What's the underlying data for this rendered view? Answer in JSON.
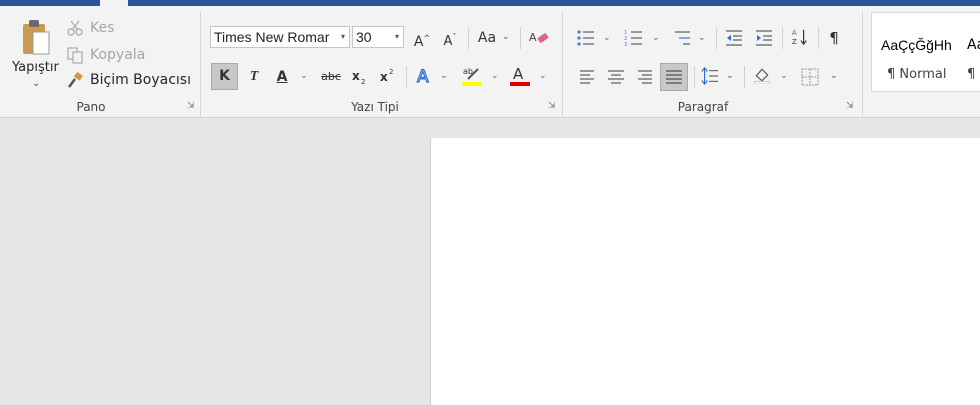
{
  "clipboard": {
    "paste_label": "Yapıştır",
    "cut_label": "Kes",
    "copy_label": "Kopyala",
    "format_painter_label": "Biçim Boyacısı",
    "group_label": "Pano"
  },
  "font": {
    "font_name": "Times New Romar",
    "font_size": "30",
    "bold_label": "K",
    "italic_label": "T",
    "underline_label": "A",
    "strike_label": "abc",
    "change_case_label": "Aa",
    "group_label": "Yazı Tipi",
    "highlight_color": "#ffff00",
    "font_color": "#e00000"
  },
  "paragraph": {
    "group_label": "Paragraf",
    "show_marks_glyph": "¶"
  },
  "styles": {
    "sample_text": "AaÇçĞğHh",
    "sample_text_2": "Aa",
    "normal_label": "¶ Normal",
    "next_label": "¶"
  },
  "colors": {
    "title_bar": "#2b579a",
    "ribbon_bg": "#f3f3f3",
    "workspace_bg": "#e6e6e6",
    "page_bg": "#ffffff"
  }
}
